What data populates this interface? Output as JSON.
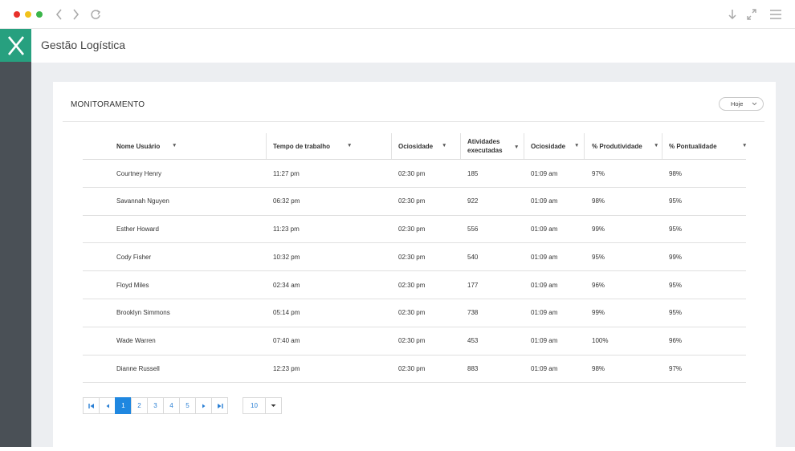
{
  "app": {
    "title": "Gestão Logística",
    "logo_letter": "X"
  },
  "colors": {
    "brand": "#27a07f",
    "sidebar": "#4a5056",
    "accent": "#1f87e0"
  },
  "card": {
    "title": "MONITORAMENTO",
    "filter_label": "Hoje"
  },
  "table": {
    "headers": {
      "nome": "Nome Usuário",
      "tempo": "Tempo de trabalho",
      "ocio1": "Ociosidade",
      "ativ1": "Atividades",
      "ativ2": "executadas",
      "ocio2": "Ociosidade",
      "prod": "% Produtividade",
      "pont": "% Pontualidade"
    },
    "rows": [
      {
        "nome": "Courtney Henry",
        "tempo": "11:27 pm",
        "ocio1": "02:30 pm",
        "ativ": "185",
        "ocio2": "01:09 am",
        "prod": "97%",
        "pont": "98%"
      },
      {
        "nome": "Savannah Nguyen",
        "tempo": "06:32 pm",
        "ocio1": "02:30 pm",
        "ativ": "922",
        "ocio2": "01:09 am",
        "prod": "98%",
        "pont": "95%"
      },
      {
        "nome": "Esther Howard",
        "tempo": "11:23 pm",
        "ocio1": "02:30 pm",
        "ativ": "556",
        "ocio2": "01:09 am",
        "prod": "99%",
        "pont": "95%"
      },
      {
        "nome": "Cody Fisher",
        "tempo": "10:32 pm",
        "ocio1": "02:30 pm",
        "ativ": "540",
        "ocio2": "01:09 am",
        "prod": "95%",
        "pont": "99%"
      },
      {
        "nome": "Floyd Miles",
        "tempo": "02:34 am",
        "ocio1": "02:30 pm",
        "ativ": "177",
        "ocio2": "01:09 am",
        "prod": "96%",
        "pont": "95%"
      },
      {
        "nome": "Brooklyn Simmons",
        "tempo": "05:14 pm",
        "ocio1": "02:30 pm",
        "ativ": "738",
        "ocio2": "01:09 am",
        "prod": "99%",
        "pont": "95%"
      },
      {
        "nome": "Wade Warren",
        "tempo": "07:40 am",
        "ocio1": "02:30 pm",
        "ativ": "453",
        "ocio2": "01:09 am",
        "prod": "100%",
        "pont": "96%"
      },
      {
        "nome": "Dianne Russell",
        "tempo": "12:23 pm",
        "ocio1": "02:30 pm",
        "ativ": "883",
        "ocio2": "01:09 am",
        "prod": "98%",
        "pont": "97%"
      }
    ]
  },
  "pagination": {
    "pages": [
      "1",
      "2",
      "3",
      "4",
      "5"
    ],
    "current": "1",
    "page_size": "10"
  },
  "icons": {
    "back": "chevron-left-icon",
    "forward": "chevron-right-icon",
    "reload": "reload-icon",
    "download": "download-icon",
    "expand": "expand-icon",
    "menu": "hamburger-menu-icon"
  }
}
